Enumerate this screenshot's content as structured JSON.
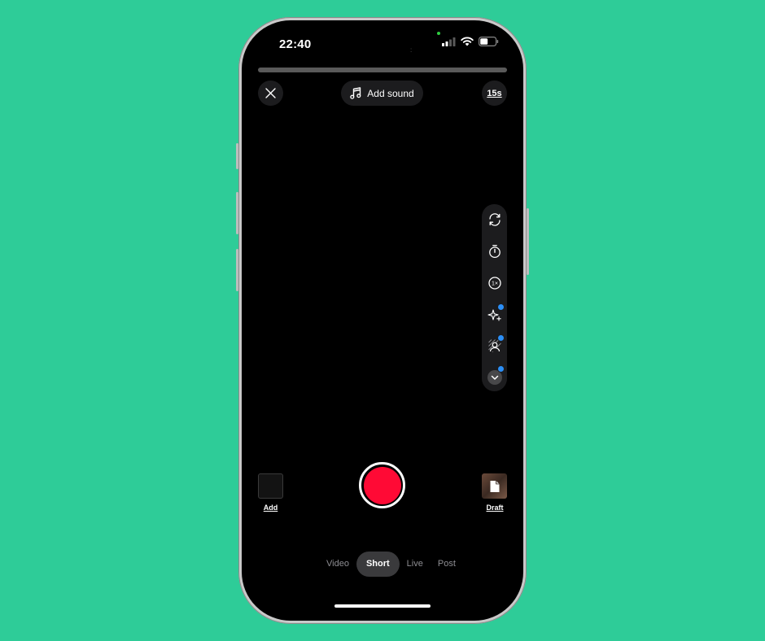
{
  "status_bar": {
    "time": "22:40",
    "tiny_text": ":"
  },
  "top_bar": {
    "close_icon": "close-icon",
    "add_sound_label": "Add sound",
    "duration_label": "15s"
  },
  "tool_rail": {
    "items": [
      {
        "icon": "flip-camera-icon"
      },
      {
        "icon": "timer-icon"
      },
      {
        "icon": "speed-icon",
        "text": "1×"
      },
      {
        "icon": "effects-sparkle-icon",
        "badge": true
      },
      {
        "icon": "green-screen-icon",
        "badge": true
      },
      {
        "icon": "chevron-down-icon",
        "badge": true
      }
    ]
  },
  "bottom": {
    "gallery_label": "Add",
    "draft_label": "Draft"
  },
  "mode_tabs": [
    {
      "label": "Video",
      "active": false
    },
    {
      "label": "Short",
      "active": true
    },
    {
      "label": "Live",
      "active": false
    },
    {
      "label": "Post",
      "active": false
    }
  ],
  "colors": {
    "background": "#2ecc98",
    "record": "#ff0a35",
    "badge": "#2b8ff7"
  }
}
